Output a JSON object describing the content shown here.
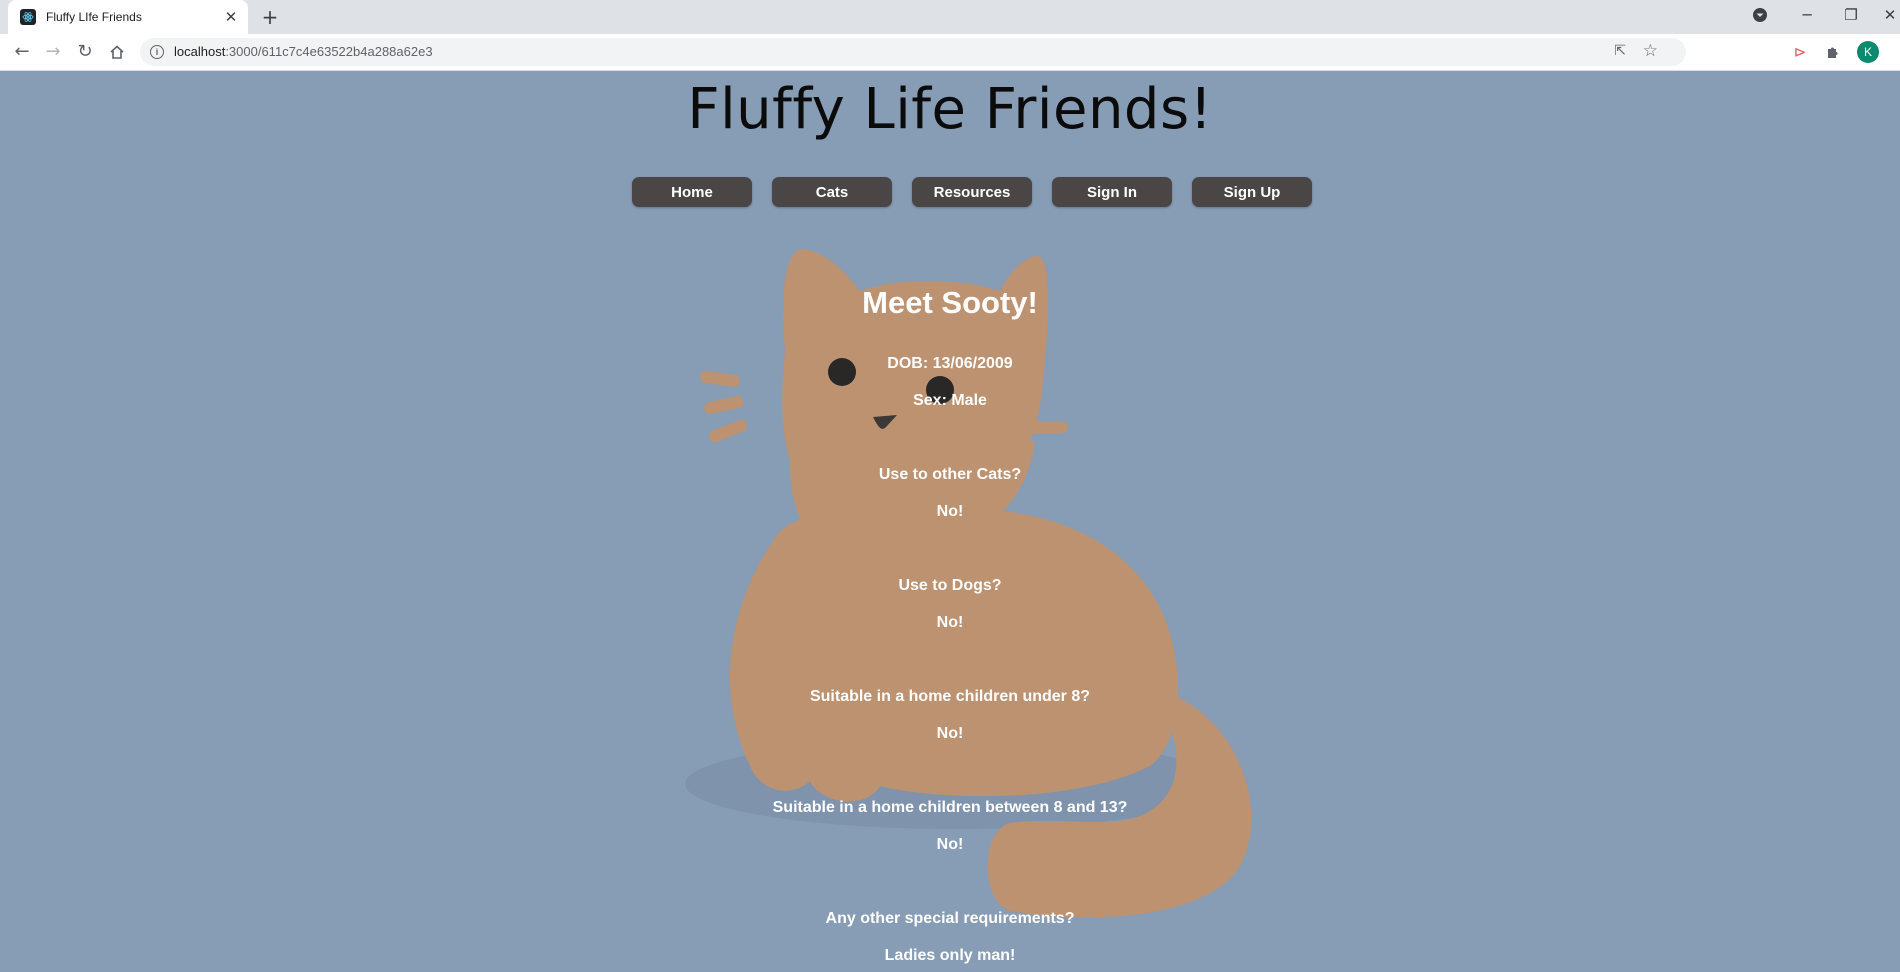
{
  "browser": {
    "tab_title": "Fluffy LIfe Friends",
    "url_host": "localhost",
    "url_path": ":3000/611c7c4e63522b4a288a62e3",
    "avatar_initial": "K"
  },
  "site": {
    "title": "Fluffy Life Friends!",
    "background_color": "#879cb5",
    "nav": [
      {
        "label": "Home"
      },
      {
        "label": "Cats"
      },
      {
        "label": "Resources"
      },
      {
        "label": "Sign In"
      },
      {
        "label": "Sign Up"
      }
    ]
  },
  "profile": {
    "heading": "Meet Sooty!",
    "dob": "DOB: 13/06/2009",
    "sex": "Sex: Male",
    "q_other_cats": "Use to other Cats?",
    "a_other_cats": "No!",
    "q_dogs": "Use to Dogs?",
    "a_dogs": "No!",
    "q_children_under_8": "Suitable in a home children under 8?",
    "a_children_under_8": "No!",
    "q_children_8_13": "Suitable in a home children between 8 and 13?",
    "a_children_8_13": "No!",
    "q_special": "Any other special requirements?",
    "a_special": "Ladies only man!"
  },
  "colors": {
    "cat_body": "#bc9271",
    "nav_button": "#4a4646"
  }
}
